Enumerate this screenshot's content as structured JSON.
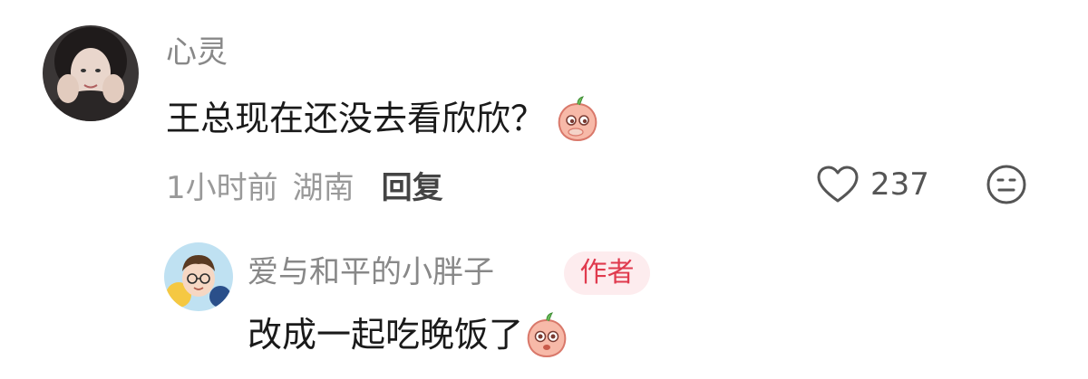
{
  "comment": {
    "username": "心灵",
    "text": "王总现在还没去看欣欣？",
    "time": "1小时前",
    "location": "湖南",
    "reply_label": "回复",
    "like_count": "237"
  },
  "reply": {
    "username": "爱与和平的小胖子",
    "badge": "作者",
    "text": "改成一起吃晚饭了"
  },
  "icons": {
    "emoji": "peach-face-emoji",
    "like": "heart-outline-icon",
    "more": "expressionless-face-icon"
  },
  "colors": {
    "username": "#888888",
    "meta": "#999999",
    "badge_bg": "#fdecee",
    "badge_text": "#e03a4e"
  }
}
